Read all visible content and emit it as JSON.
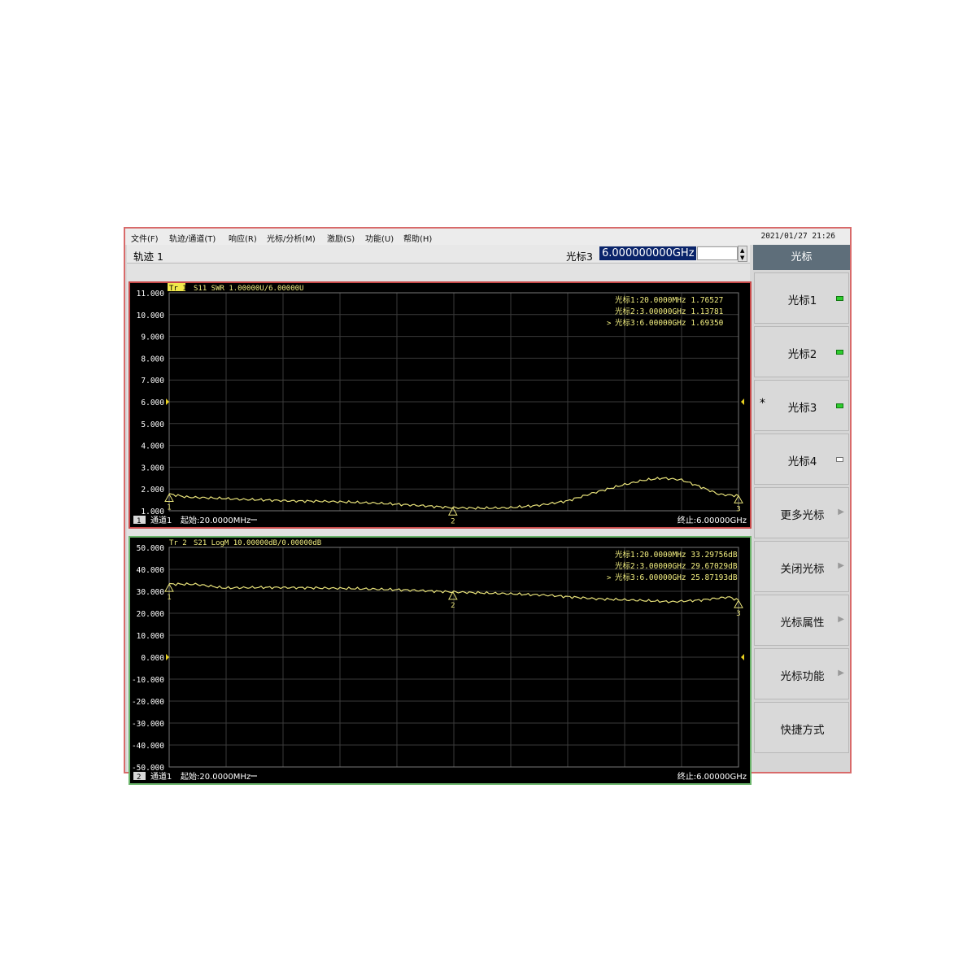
{
  "menu": [
    {
      "label": "文件(F)"
    },
    {
      "label": "轨迹/通道(T)"
    },
    {
      "label": "响应(R)"
    },
    {
      "label": "光标/分析(M)"
    },
    {
      "label": "激励(S)"
    },
    {
      "label": "功能(U)"
    },
    {
      "label": "帮助(H)"
    }
  ],
  "datetime": "2021/01/27 21:26",
  "tracebar": {
    "title": "轨迹 1",
    "marker_label": "光标3",
    "marker_freq": "6.000000000GHz"
  },
  "softkeys": {
    "header": "光标",
    "keys": [
      {
        "label": "光标1",
        "indicator": "on"
      },
      {
        "label": "光标2",
        "indicator": "on"
      },
      {
        "label": "光标3",
        "indicator": "on",
        "active": true,
        "star": "*"
      },
      {
        "label": "光标4",
        "indicator": "off"
      },
      {
        "label": "更多光标",
        "submenu": true
      },
      {
        "label": "关闭光标",
        "submenu": true
      },
      {
        "label": "光标属性",
        "submenu": true
      },
      {
        "label": "光标功能",
        "submenu": true
      },
      {
        "label": "快捷方式"
      }
    ]
  },
  "colors": {
    "trace": "#e8e27a",
    "grid": "#3a3a3a",
    "text": "#ffffff",
    "marker_text": "#f2ee80"
  },
  "chart_data": [
    {
      "type": "line",
      "header": "Tr 1  S11 SWR 1.00000U/6.00000U",
      "ylim": [
        1,
        11
      ],
      "yticks": [
        "11.000",
        "10.000",
        "9.000",
        "8.000",
        "7.000",
        "6.000",
        "5.000",
        "4.000",
        "3.000",
        "2.000",
        "1.000"
      ],
      "xlim_ghz": [
        0.02,
        6.0
      ],
      "series": [
        {
          "values": [
            [
              0.02,
              1.77
            ],
            [
              0.2,
              1.63
            ],
            [
              0.5,
              1.58
            ],
            [
              0.8,
              1.52
            ],
            [
              1.0,
              1.5
            ],
            [
              1.3,
              1.45
            ],
            [
              1.6,
              1.44
            ],
            [
              1.9,
              1.4
            ],
            [
              2.2,
              1.35
            ],
            [
              2.5,
              1.28
            ],
            [
              2.8,
              1.2
            ],
            [
              3.0,
              1.14
            ],
            [
              3.3,
              1.12
            ],
            [
              3.6,
              1.14
            ],
            [
              3.9,
              1.25
            ],
            [
              4.2,
              1.45
            ],
            [
              4.5,
              1.85
            ],
            [
              4.8,
              2.2
            ],
            [
              5.0,
              2.4
            ],
            [
              5.2,
              2.5
            ],
            [
              5.4,
              2.42
            ],
            [
              5.6,
              2.1
            ],
            [
              5.8,
              1.75
            ],
            [
              6.0,
              1.69
            ]
          ]
        }
      ],
      "markers": [
        {
          "label": "光标1:20.0000MHz 1.76527",
          "x": 0.02,
          "y": 1.76527,
          "num": "1"
        },
        {
          "label": "光标2:3.00000GHz 1.13781",
          "x": 3.0,
          "y": 1.13781,
          "num": "2"
        },
        {
          "label": "光标3:6.00000GHz 1.69350",
          "x": 6.0,
          "y": 1.6935,
          "num": "3",
          "active": true
        }
      ],
      "ref_level": 6,
      "footer": {
        "channel_num": "1",
        "channel": "通道1",
        "start": "起始:20.0000MHz",
        "stop": "终止:6.00000GHz"
      }
    },
    {
      "type": "line",
      "header": "Tr 2  S21 LogM 10.00000dB/0.00000dB",
      "ylim": [
        -50,
        50
      ],
      "yticks": [
        "50.000",
        "40.000",
        "30.000",
        "20.000",
        "10.000",
        "0.000",
        "-10.000",
        "-20.000",
        "-30.000",
        "-40.000",
        "-50.000"
      ],
      "xlim_ghz": [
        0.02,
        6.0
      ],
      "series": [
        {
          "values": [
            [
              0.02,
              33.3
            ],
            [
              0.3,
              33.2
            ],
            [
              0.6,
              31.5
            ],
            [
              1.0,
              31.8
            ],
            [
              1.5,
              31.6
            ],
            [
              2.0,
              31.2
            ],
            [
              2.5,
              30.6
            ],
            [
              3.0,
              29.7
            ],
            [
              3.5,
              29.0
            ],
            [
              4.0,
              28.2
            ],
            [
              4.5,
              26.6
            ],
            [
              5.0,
              25.8
            ],
            [
              5.3,
              25.2
            ],
            [
              5.6,
              26.0
            ],
            [
              5.9,
              27.4
            ],
            [
              6.0,
              25.9
            ]
          ]
        }
      ],
      "markers": [
        {
          "label": "光标1:20.0000MHz 33.29756dB",
          "x": 0.02,
          "y": 33.29756,
          "num": "1"
        },
        {
          "label": "光标2:3.00000GHz 29.67029dB",
          "x": 3.0,
          "y": 29.67029,
          "num": "2"
        },
        {
          "label": "光标3:6.00000GHz 25.87193dB",
          "x": 6.0,
          "y": 25.87193,
          "num": "3",
          "active": true
        }
      ],
      "ref_level": 0,
      "footer": {
        "channel_num": "2",
        "channel": "通道1",
        "start": "起始:20.0000MHz",
        "stop": "终止:6.00000GHz"
      }
    }
  ]
}
